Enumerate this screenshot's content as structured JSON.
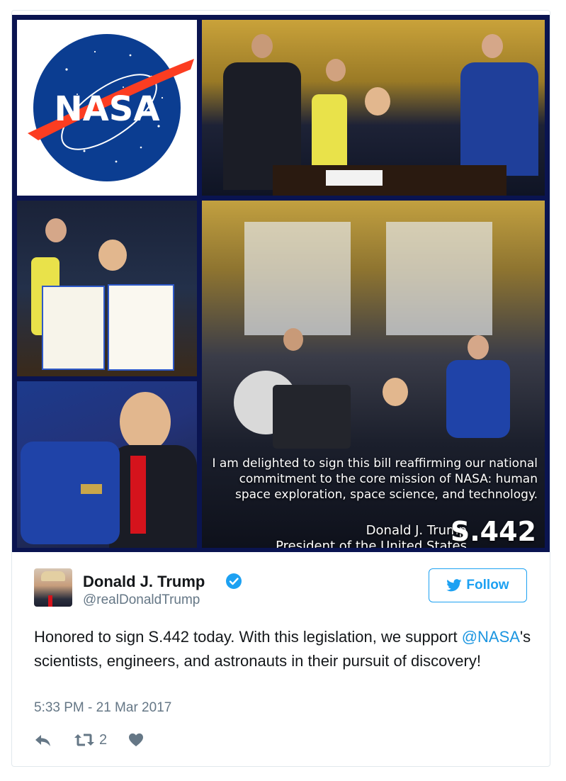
{
  "collage": {
    "quote_lines": [
      "I am delighted to sign this bill reaffirming our national",
      "commitment to the core mission of NASA: human",
      "space exploration, space science, and technology."
    ],
    "signature_name": "Donald J. Trump",
    "signature_title": "President of the United States",
    "bill_number": "S.442",
    "logo_text": "NASA"
  },
  "tweet": {
    "name": "Donald J. Trump",
    "handle": "@realDonaldTrump",
    "follow_label": "Follow",
    "text_before": "Honored to sign S.442 today. With this legislation, we support ",
    "mention": "@NASA",
    "text_after": "'s scientists, engineers, and astronauts in their pursuit of discovery!",
    "timestamp": "5:33 PM - 21 Mar 2017",
    "retweet_count": "2"
  },
  "colors": {
    "accent": "#1da1f2",
    "mention": "#1b95e0",
    "muted": "#657786",
    "text": "#14171a"
  },
  "icons": [
    "verified-badge-icon",
    "twitter-bird-icon",
    "reply-icon",
    "retweet-icon",
    "heart-icon"
  ]
}
